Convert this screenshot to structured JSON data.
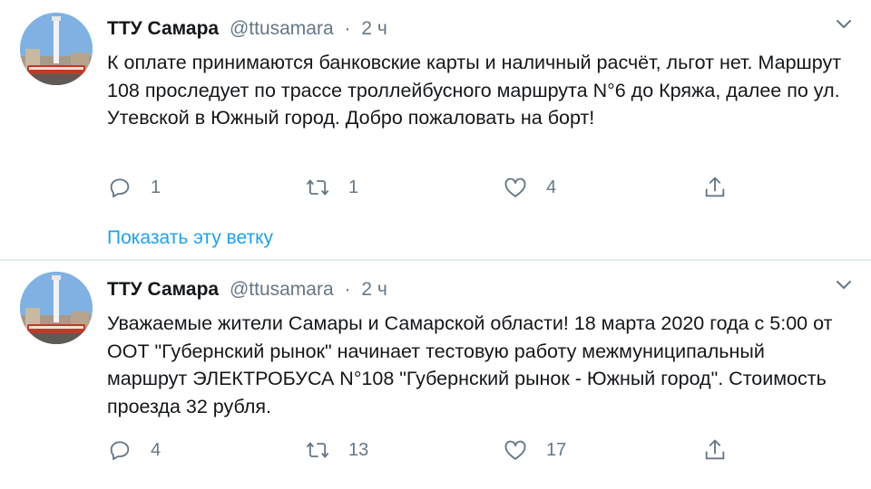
{
  "tweets": [
    {
      "author_name": "ТТУ Самара",
      "handle": "@ttusamara",
      "separator": "·",
      "time": "2 ч",
      "text": "К оплате принимаются банковские карты и наличный расчёт, льгот нет. Маршрут 108 проследует по трассе троллейбусного маршрута N°6 до Кряжа, далее по ул. Утевской в Южный город. Добро пожаловать на борт!",
      "reply_count": "1",
      "retweet_count": "1",
      "like_count": "4",
      "show_thread": "Показать эту ветку"
    },
    {
      "author_name": "ТТУ Самара",
      "handle": "@ttusamara",
      "separator": "·",
      "time": "2 ч",
      "text": "Уважаемые жители Самары и Самарской области! 18 марта 2020 года с 5:00 от ООТ \"Губернский рынок\" начинает тестовую работу межмуниципальный маршрут ЭЛЕКТРОБУСА N°108 \"Губернский рынок - Южный город\". Стоимость проезда 32 рубля.",
      "reply_count": "4",
      "retweet_count": "13",
      "like_count": "17"
    }
  ],
  "icons": {
    "reply": "reply-icon",
    "retweet": "retweet-icon",
    "like": "heart-icon",
    "share": "share-icon",
    "menu": "chevron-down-icon"
  },
  "colors": {
    "text": "#14171a",
    "muted": "#657786",
    "link": "#1da1f2",
    "divider": "#e6ecf0"
  }
}
